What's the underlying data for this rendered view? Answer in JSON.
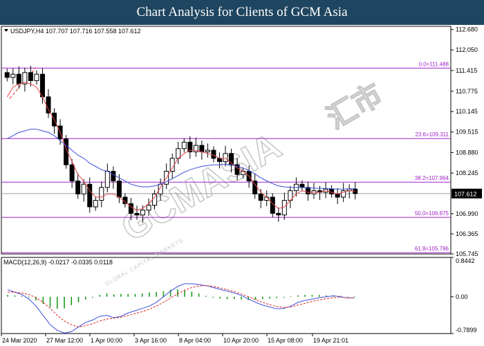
{
  "banner": {
    "title": "Chart Analysis for Clients of GCM Asia"
  },
  "watermark": {
    "brand": "GCMASIA",
    "cn": "汇市",
    "tagline": "GLOBAL CAPITAL MARKETS"
  },
  "colors": {
    "frame": "#000000",
    "bull": "#000000",
    "bear": "#000000",
    "ma_fast": "#e8454a",
    "ma_slow": "#3b4fd8",
    "fib": "#a020c8",
    "macd_hist": "#1a9a1a",
    "macd_signal": "#e02020",
    "price_line": "#9aa0a6"
  },
  "chart_data": [
    {
      "type": "candlestick",
      "header": "USDJPY,H4  107.707 107.716 107.558 107.612",
      "symbol": "USDJPY",
      "timeframe": "H4",
      "ohlc_last": {
        "open": 107.707,
        "high": 107.716,
        "low": 107.558,
        "close": 107.612
      },
      "current_price": "107.612",
      "ylim": [
        105.745,
        112.78
      ],
      "y_ticks": [
        "112.680",
        "112.050",
        "111.415",
        "110.775",
        "110.145",
        "109.515",
        "108.880",
        "108.245",
        "107.612",
        "106.990",
        "106.365",
        "105.745"
      ],
      "y_tick_values": [
        112.68,
        112.05,
        111.415,
        110.775,
        110.145,
        109.515,
        108.88,
        108.245,
        107.612,
        106.99,
        106.365,
        105.745
      ],
      "x_ticks": [
        "24 Mar 2020",
        "27 Mar 12:00",
        "1 Apr 00:00",
        "3 Apr 16:00",
        "8 Apr 04:00",
        "10 Apr 20:00",
        "15 Apr 08:00",
        "19 Apr 21:01"
      ],
      "fib_levels": [
        {
          "label": "0.0=111.488",
          "value": 111.488
        },
        {
          "label": "23.6=109.311",
          "value": 109.311
        },
        {
          "label": "38.2=107.964",
          "value": 107.964
        },
        {
          "label": "50.0=106.875",
          "value": 106.875
        },
        {
          "label": "61.8=105.786",
          "value": 105.786
        }
      ],
      "close_path": [
        111.2,
        111.3,
        111.0,
        111.35,
        111.1,
        111.3,
        110.6,
        110.1,
        109.7,
        109.3,
        108.5,
        108.0,
        107.6,
        107.9,
        107.2,
        107.4,
        107.8,
        108.3,
        108.0,
        107.5,
        107.3,
        107.0,
        106.95,
        107.1,
        107.25,
        107.6,
        107.9,
        108.3,
        108.7,
        109.0,
        109.2,
        108.9,
        109.1,
        108.9,
        108.95,
        108.7,
        108.6,
        108.85,
        108.5,
        108.2,
        108.3,
        108.0,
        107.6,
        107.4,
        107.5,
        107.0,
        106.95,
        107.4,
        107.7,
        107.9,
        107.8,
        107.6,
        107.7,
        107.65,
        107.75,
        107.6,
        107.5,
        107.7,
        107.75,
        107.61
      ],
      "ma_fast": [
        110.6,
        110.9,
        111.0,
        111.05,
        111.0,
        110.9,
        110.6,
        110.2,
        109.9,
        109.5,
        109.0,
        108.6,
        108.2,
        108.0,
        107.7,
        107.5,
        107.5,
        107.6,
        107.6,
        107.5,
        107.35,
        107.2,
        107.1,
        107.15,
        107.3,
        107.5,
        107.8,
        108.1,
        108.4,
        108.7,
        108.85,
        108.95,
        108.95,
        108.9,
        108.85,
        108.8,
        108.7,
        108.7,
        108.55,
        108.4,
        108.3,
        108.15,
        107.9,
        107.65,
        107.5,
        107.3,
        107.15,
        107.2,
        107.4,
        107.6,
        107.7,
        107.65,
        107.65,
        107.65,
        107.7,
        107.65,
        107.6,
        107.65,
        107.7,
        107.68
      ],
      "ma_slow": [
        109.3,
        109.4,
        109.5,
        109.55,
        109.6,
        109.6,
        109.55,
        109.5,
        109.4,
        109.25,
        109.1,
        108.95,
        108.8,
        108.7,
        108.55,
        108.45,
        108.35,
        108.3,
        108.2,
        108.1,
        108.0,
        107.9,
        107.85,
        107.82,
        107.82,
        107.85,
        107.9,
        107.98,
        108.07,
        108.17,
        108.27,
        108.35,
        108.4,
        108.45,
        108.48,
        108.5,
        108.5,
        108.52,
        108.5,
        108.45,
        108.4,
        108.32,
        108.22,
        108.1,
        108.0,
        107.92,
        107.85,
        107.82,
        107.8,
        107.8,
        107.8,
        107.78,
        107.78,
        107.77,
        107.77,
        107.76,
        107.75,
        107.75,
        107.76,
        107.76
      ]
    },
    {
      "type": "macd",
      "header": "MACD(12,26,9) -0.0217 -0.0335 0.0118",
      "params": "12,26,9",
      "values": {
        "macd": -0.0217,
        "signal": -0.0335,
        "hist": 0.0118
      },
      "ylim": [
        -0.7899,
        0.8442
      ],
      "y_ticks": [
        "0.8442",
        "0.00",
        "-0.7899"
      ],
      "y_tick_values": [
        0.8442,
        0.0,
        -0.7899
      ],
      "macd_line": [
        0.15,
        0.1,
        0.05,
        -0.05,
        -0.2,
        -0.4,
        -0.6,
        -0.72,
        -0.78,
        -0.75,
        -0.65,
        -0.55,
        -0.5,
        -0.42,
        -0.4,
        -0.45,
        -0.42,
        -0.35,
        -0.3,
        -0.25,
        -0.2,
        -0.12,
        0.0,
        0.12,
        0.22,
        0.28,
        0.28,
        0.26,
        0.24,
        0.2,
        0.16,
        0.12,
        0.08,
        0.03,
        -0.05,
        -0.12,
        -0.18,
        -0.22,
        -0.26,
        -0.25,
        -0.2,
        -0.12,
        -0.08,
        -0.05,
        -0.02,
        0.0,
        0.02,
        0.0,
        -0.03,
        -0.02
      ],
      "signal_line": [
        0.1,
        0.1,
        0.08,
        0.05,
        -0.02,
        -0.12,
        -0.25,
        -0.4,
        -0.52,
        -0.6,
        -0.65,
        -0.62,
        -0.58,
        -0.52,
        -0.48,
        -0.46,
        -0.44,
        -0.4,
        -0.36,
        -0.32,
        -0.27,
        -0.2,
        -0.12,
        -0.03,
        0.06,
        0.14,
        0.2,
        0.23,
        0.24,
        0.22,
        0.19,
        0.15,
        0.11,
        0.06,
        0.0,
        -0.06,
        -0.12,
        -0.17,
        -0.21,
        -0.23,
        -0.22,
        -0.18,
        -0.14,
        -0.1,
        -0.07,
        -0.04,
        -0.02,
        -0.01,
        -0.02,
        -0.03
      ],
      "histogram": [
        0.04,
        0.03,
        0.02,
        -0.02,
        -0.08,
        -0.15,
        -0.22,
        -0.26,
        -0.25,
        -0.18,
        -0.12,
        -0.06,
        -0.02,
        0.04,
        0.07,
        0.05,
        0.06,
        0.06,
        0.06,
        0.07,
        0.09,
        0.1,
        0.12,
        0.15,
        0.16,
        0.14,
        0.11,
        0.07,
        0.02,
        -0.02,
        -0.04,
        -0.05,
        -0.05,
        -0.06,
        -0.07,
        -0.06,
        -0.05,
        -0.04,
        -0.03,
        -0.02,
        0.01,
        0.03,
        0.04,
        0.04,
        0.04,
        0.03,
        0.03,
        0.02,
        0.01,
        0.01
      ]
    }
  ]
}
